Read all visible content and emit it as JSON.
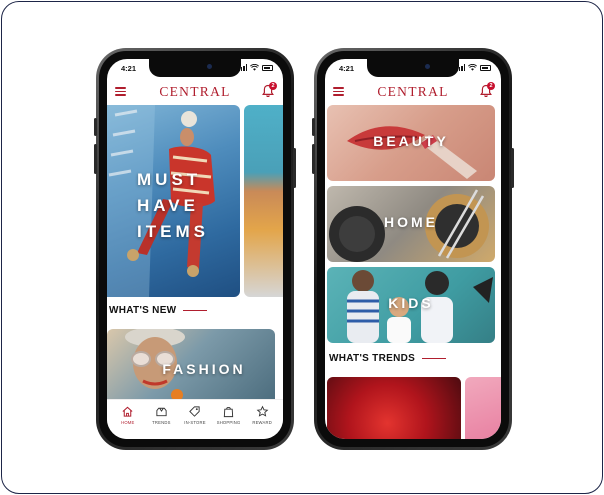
{
  "colors": {
    "brand": "#b01e2e",
    "frame": "#1d2547"
  },
  "left_phone": {
    "status_time": "4:21",
    "brand": "CENTRAL",
    "notification_count": "2",
    "hero_label": "MUST HAVE ITEMS",
    "section_title": "WHAT'S NEW",
    "card_label": "FASHION",
    "tabs": [
      {
        "label": "HOME",
        "icon": "home-icon",
        "active": true
      },
      {
        "label": "TRENDS",
        "icon": "trends-icon",
        "active": false
      },
      {
        "label": "IN-STORE",
        "icon": "tag-icon",
        "active": false
      },
      {
        "label": "SHOPPING",
        "icon": "shopping-bag-icon",
        "active": false
      },
      {
        "label": "REWARD",
        "icon": "star-icon",
        "active": false
      }
    ]
  },
  "right_phone": {
    "status_time": "4:21",
    "brand": "CENTRAL",
    "notification_count": "2",
    "categories": [
      {
        "label": "BEAUTY"
      },
      {
        "label": "HOME"
      },
      {
        "label": "KIDS"
      }
    ],
    "section_title": "WHAT'S TRENDS"
  }
}
